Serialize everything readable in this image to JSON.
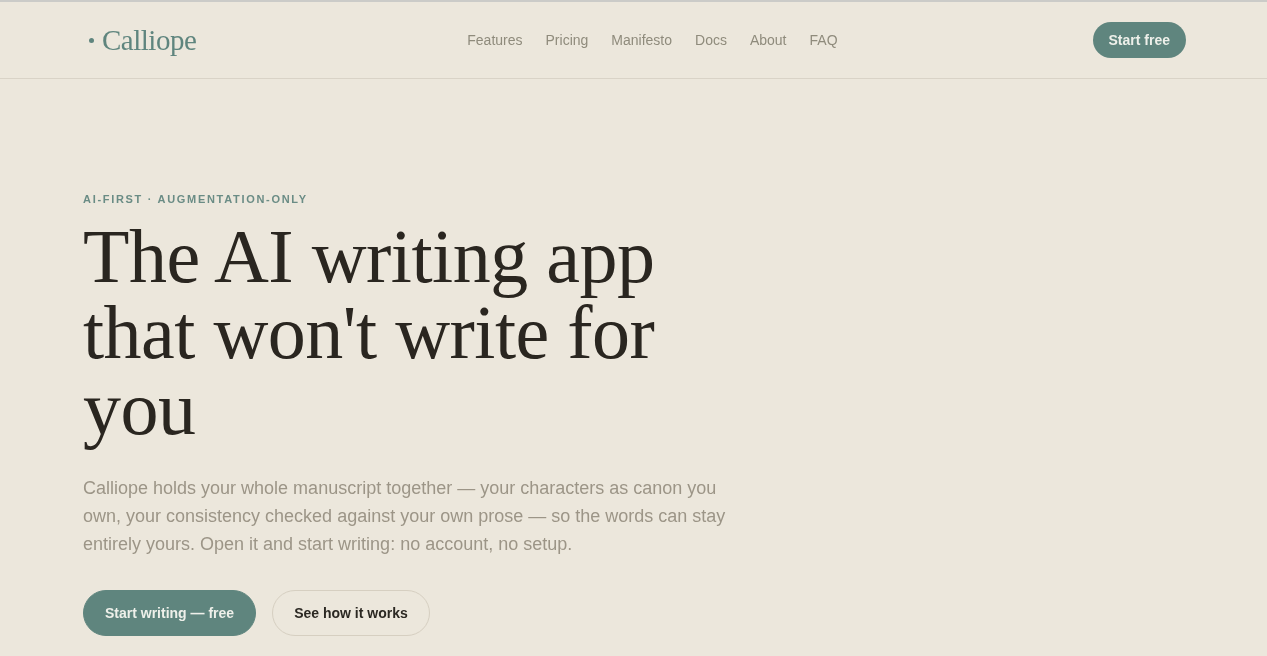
{
  "header": {
    "logo": "Calliope",
    "nav": [
      {
        "label": "Features"
      },
      {
        "label": "Pricing"
      },
      {
        "label": "Manifesto"
      },
      {
        "label": "Docs"
      },
      {
        "label": "About"
      },
      {
        "label": "FAQ"
      }
    ],
    "cta": "Start free"
  },
  "hero": {
    "eyebrow": "AI-FIRST · AUGMENTATION-ONLY",
    "heading": "The AI writing app that won't write for you",
    "body": "Calliope holds your whole manuscript together — your characters as canon you own, your consistency checked against your own prose — so the words can stay entirely yours. Open it and start writing: no account, no setup.",
    "actions": [
      {
        "label": "Start writing — free",
        "kind": "primary"
      },
      {
        "label": "See how it works",
        "kind": "secondary"
      }
    ]
  }
}
